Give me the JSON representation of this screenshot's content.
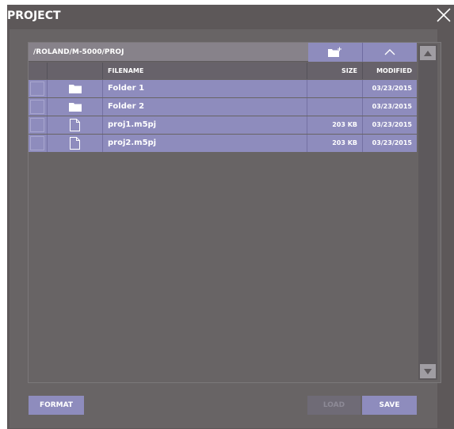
{
  "window": {
    "title": "PROJECT"
  },
  "browser": {
    "path": "/ROLAND/M-5000/PROJ",
    "columns": {
      "filename": "FILENAME",
      "size": "SIZE",
      "modified": "MODIFIED"
    },
    "files": [
      {
        "name": "Folder 1",
        "type": "folder-icon",
        "size": "",
        "modified": "03/23/2015"
      },
      {
        "name": "Folder 2",
        "type": "folder-icon",
        "size": "",
        "modified": "03/23/2015"
      },
      {
        "name": "proj1.m5pj",
        "type": "file-icon",
        "size": "203 KB",
        "modified": "03/23/2015"
      },
      {
        "name": "proj2.m5pj",
        "type": "file-icon",
        "size": "203 KB",
        "modified": "03/23/2015"
      }
    ]
  },
  "buttons": {
    "format": "FORMAT",
    "load": "LOAD",
    "save": "SAVE"
  },
  "colors": {
    "accent": "#8e8cbd",
    "background": "#5d5859",
    "disabled": "#6f6b76"
  }
}
